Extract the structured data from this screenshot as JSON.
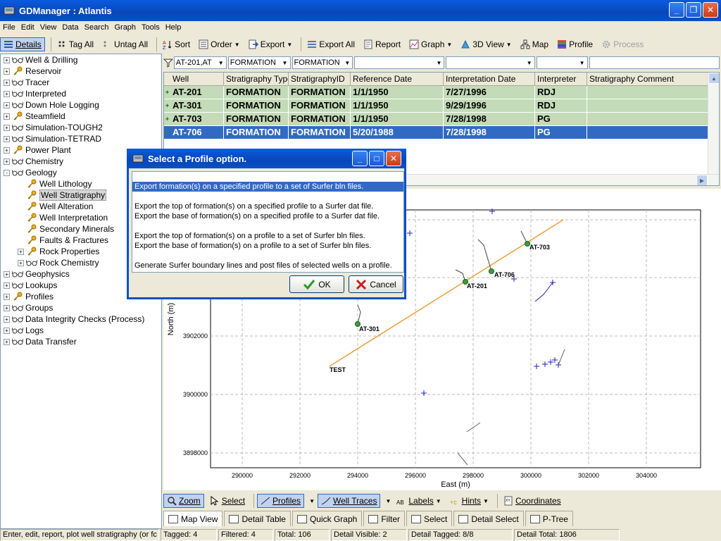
{
  "window": {
    "title": "GDManager : Atlantis"
  },
  "menu": [
    "File",
    "Edit",
    "View",
    "Data",
    "Search",
    "Graph",
    "Tools",
    "Help"
  ],
  "toolbar": {
    "details": "Details",
    "tag_all": "Tag All",
    "untag_all": "Untag All",
    "sort": "Sort",
    "order": "Order",
    "export": "Export",
    "export_all": "Export All",
    "report": "Report",
    "graph": "Graph",
    "view3d": "3D View",
    "map": "Map",
    "profile": "Profile",
    "process": "Process"
  },
  "tree": [
    {
      "label": "Well & Drilling",
      "icon": "glasses",
      "level": 0,
      "exp": "+"
    },
    {
      "label": "Reservoir",
      "icon": "key",
      "level": 0,
      "exp": "+"
    },
    {
      "label": "Tracer",
      "icon": "glasses",
      "level": 0,
      "exp": "+"
    },
    {
      "label": "Interpreted",
      "icon": "glasses",
      "level": 0,
      "exp": "+"
    },
    {
      "label": "Down Hole Logging",
      "icon": "glasses",
      "level": 0,
      "exp": "+"
    },
    {
      "label": "Steamfield",
      "icon": "key",
      "level": 0,
      "exp": "+"
    },
    {
      "label": "Simulation-TOUGH2",
      "icon": "glasses",
      "level": 0,
      "exp": "+"
    },
    {
      "label": "Simulation-TETRAD",
      "icon": "glasses",
      "level": 0,
      "exp": "+"
    },
    {
      "label": "Power Plant",
      "icon": "key",
      "level": 0,
      "exp": "+"
    },
    {
      "label": "Chemistry",
      "icon": "glasses",
      "level": 0,
      "exp": "+"
    },
    {
      "label": "Geology",
      "icon": "glasses",
      "level": 0,
      "exp": "-"
    },
    {
      "label": "Well Lithology",
      "icon": "key",
      "level": 1,
      "exp": ""
    },
    {
      "label": "Well Stratigraphy",
      "icon": "key",
      "level": 1,
      "exp": "",
      "selected": true
    },
    {
      "label": "Well Alteration",
      "icon": "key",
      "level": 1,
      "exp": ""
    },
    {
      "label": "Well Interpretation",
      "icon": "key",
      "level": 1,
      "exp": ""
    },
    {
      "label": "Secondary Minerals",
      "icon": "key",
      "level": 1,
      "exp": ""
    },
    {
      "label": "Faults & Fractures",
      "icon": "key",
      "level": 1,
      "exp": ""
    },
    {
      "label": "Rock Properties",
      "icon": "key",
      "level": 1,
      "exp": "+"
    },
    {
      "label": "Rock Chemistry",
      "icon": "glasses",
      "level": 1,
      "exp": "+"
    },
    {
      "label": "Geophysics",
      "icon": "glasses",
      "level": 0,
      "exp": "+"
    },
    {
      "label": "Lookups",
      "icon": "glasses",
      "level": 0,
      "exp": "+"
    },
    {
      "label": "Profiles",
      "icon": "key",
      "level": 0,
      "exp": "+"
    },
    {
      "label": "Groups",
      "icon": "glasses",
      "level": 0,
      "exp": "+"
    },
    {
      "label": "Data Integrity Checks (Process)",
      "icon": "glasses",
      "level": 0,
      "exp": "+"
    },
    {
      "label": "Logs",
      "icon": "glasses",
      "level": 0,
      "exp": "+"
    },
    {
      "label": "Data Transfer",
      "icon": "glasses",
      "level": 0,
      "exp": "+"
    }
  ],
  "filters": [
    "AT-201,AT",
    "FORMATION",
    "FORMATION",
    "",
    "",
    "",
    ""
  ],
  "grid": {
    "columns": [
      "Well",
      "Stratigraphy Type",
      "StratigraphyID",
      "Reference Date",
      "Interpretation Date",
      "Interpreter",
      "Stratigraphy Comment"
    ],
    "rows": [
      [
        "AT-201",
        "FORMATION",
        "FORMATION",
        "1/1/1950",
        "7/27/1996",
        "RDJ",
        ""
      ],
      [
        "AT-301",
        "FORMATION",
        "FORMATION",
        "1/1/1950",
        "9/29/1996",
        "RDJ",
        ""
      ],
      [
        "AT-703",
        "FORMATION",
        "FORMATION",
        "1/1/1950",
        "7/28/1998",
        "PG",
        ""
      ],
      [
        "AT-706",
        "FORMATION",
        "FORMATION",
        "5/20/1988",
        "7/28/1998",
        "PG",
        ""
      ]
    ],
    "selected_row": 3
  },
  "map": {
    "xlabel": "East (m)",
    "ylabel": "North (m)",
    "xticks": [
      "290000",
      "292000",
      "294000",
      "296000",
      "298000",
      "300000",
      "302000",
      "304000"
    ],
    "yticks": [
      "3902000",
      "3900000",
      "3898000"
    ],
    "profile_label": "TEST",
    "wells": [
      "AT-703",
      "AT-706",
      "AT-201",
      "AT-301"
    ],
    "profile_color": "#f0a040"
  },
  "mapbar": {
    "zoom": "Zoom",
    "select": "Select",
    "profiles": "Profiles",
    "well_traces": "Well Traces",
    "labels": "Labels",
    "hints": "Hints",
    "coordinates": "Coordinates"
  },
  "tabs": [
    "Map View",
    "Detail Table",
    "Quick Graph",
    "Filter",
    "Select",
    "Detail Select",
    "P-Tree"
  ],
  "status": {
    "hint": "Enter, edit, report, plot well stratigraphy (or fc",
    "tagged": "Tagged: 4",
    "filtered": "Filtered: 4",
    "total": "Total: 106",
    "detail_visible": "Detail Visible: 2",
    "detail_tagged": "Detail Tagged: 8/8",
    "detail_total": "Detail Total: 1806"
  },
  "dialog": {
    "title": "Select a Profile option.",
    "options": [
      "Export formation(s) on a specified profile to a set of Surfer bln files.",
      "",
      "Export the top of formation(s) on a specified profile to a Surfer dat file.",
      "Export the base of formation(s) on a specified profile to a Surfer dat file.",
      "",
      "Export the top of formation(s) on a profile to a set of Surfer bln files.",
      "Export the base of formation(s) on a profile to a set of Surfer bln files.",
      "",
      "Generate Surfer boundary lines and post files of selected wells on a profile."
    ],
    "selected": 0,
    "ok": "OK",
    "cancel": "Cancel"
  }
}
